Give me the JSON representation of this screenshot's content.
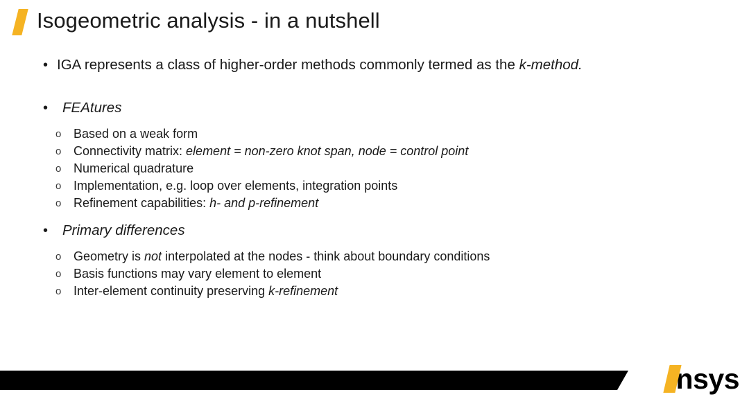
{
  "slide": {
    "title": "Isogeometric analysis - in a nutshell",
    "accent_color": "#f5b323",
    "text_color": "#1a1a1a",
    "background_color": "#ffffff"
  },
  "bullets": {
    "level1_marker": "•",
    "level2_marker": "o",
    "intro": {
      "text_before_italic": "IGA represents a class of higher-order methods commonly termed as the ",
      "italic": "k-method."
    },
    "sections": [
      {
        "heading": "FEAtures",
        "items": [
          {
            "plain": "Based on a weak form",
            "italic": "",
            "tail": ""
          },
          {
            "plain": "Connectivity matrix: ",
            "italic": "element = non-zero knot span, node = control point",
            "tail": ""
          },
          {
            "plain": "Numerical quadrature",
            "italic": "",
            "tail": ""
          },
          {
            "plain": "Implementation, e.g. loop over elements, integration points",
            "italic": "",
            "tail": ""
          },
          {
            "plain": "Refinement capabilities: ",
            "italic": "h- and p-refinement",
            "tail": ""
          }
        ]
      },
      {
        "heading": "Primary differences",
        "items": [
          {
            "plain": "Geometry is ",
            "italic": "not",
            "tail": " interpolated at the nodes - think about boundary conditions"
          },
          {
            "plain": "Basis functions may vary element to element",
            "italic": "",
            "tail": ""
          },
          {
            "plain": "Inter-element continuity preserving ",
            "italic": "k-refinement",
            "tail": ""
          }
        ]
      }
    ]
  },
  "footer": {
    "logo_text": "nsys",
    "bar_color": "#000000",
    "logo_slash_color": "#f5b323"
  }
}
